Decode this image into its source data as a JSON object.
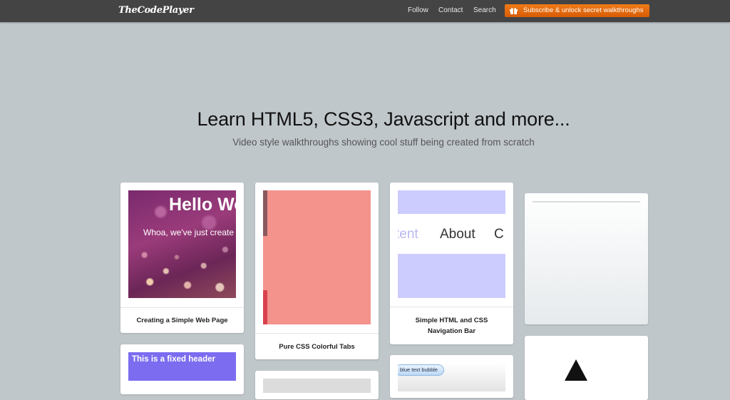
{
  "header": {
    "logo": "TheCodePlayer",
    "nav": [
      "Follow",
      "Contact",
      "Search"
    ],
    "subscribe_label": "Subscribe & unlock secret walkthroughs",
    "subscribe_icon": "gift-icon"
  },
  "hero": {
    "title": "Learn HTML5, CSS3, Javascript and more...",
    "subtitle": "Video style walkthroughs showing cool stuff being created from scratch"
  },
  "cards": [
    {
      "title": "Creating a Simple Web Page",
      "thumb_heading": "Hello Wo",
      "thumb_text": "Whoa, we've just create"
    },
    {
      "title": "Pure CSS Colorful Tabs"
    },
    {
      "title_line1": "Simple HTML and CSS",
      "title_line2": "Navigation Bar",
      "thumb_left": "tent",
      "thumb_mid": "About",
      "thumb_right": "C"
    },
    {
      "title": ""
    },
    {
      "thumb_text": "This is a fixed header"
    },
    {
      "thumb_text": "blue text bubble"
    }
  ],
  "colors": {
    "background": "#c0c7cb",
    "topbar": "#444444",
    "accent": "#e56a0f",
    "tab_red": "#f4928c",
    "nav_lavender": "#ccccff",
    "fixed_header_purple": "#7b6cf0"
  }
}
